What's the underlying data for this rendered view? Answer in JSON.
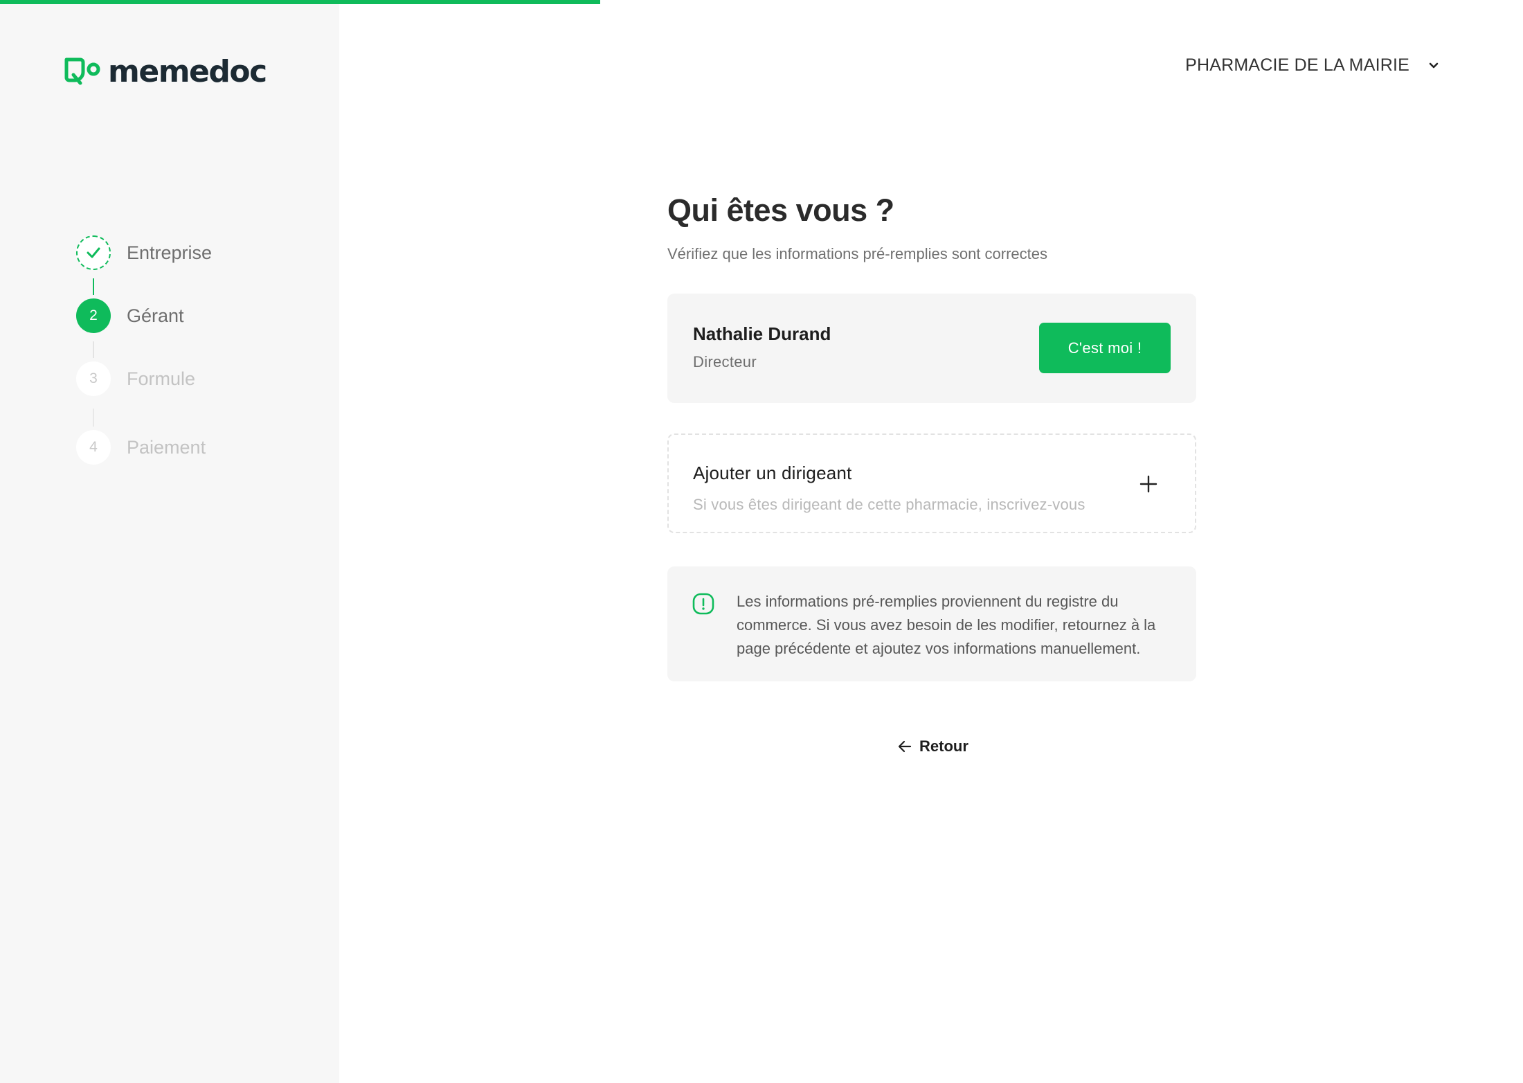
{
  "progress": {
    "fraction": 0.394,
    "color": "#0fbb5b"
  },
  "brand": {
    "name": "memedoc",
    "accent": "#0fbb5b"
  },
  "header": {
    "organization": "PHARMACIE DE LA MAIRIE"
  },
  "steps": [
    {
      "number": "1",
      "label": "Entreprise",
      "status": "done"
    },
    {
      "number": "2",
      "label": "Gérant",
      "status": "active"
    },
    {
      "number": "3",
      "label": "Formule",
      "status": "todo"
    },
    {
      "number": "4",
      "label": "Paiement",
      "status": "todo"
    }
  ],
  "main": {
    "title": "Qui êtes vous ?",
    "subtitle": "Vérifiez que les informations pré-remplies sont correctes",
    "person": {
      "name": "Nathalie Durand",
      "role": "Directeur",
      "cta": "C'est moi !"
    },
    "add_leader": {
      "title": "Ajouter un dirigeant",
      "description": "Si vous êtes dirigeant de cette pharmacie, inscrivez-vous"
    },
    "info": "Les informations pré-remplies proviennent du registre du commerce. Si vous avez besoin de les modifier, retournez à la page précédente et ajoutez vos informations manuellement.",
    "back_label": "Retour"
  },
  "icons": {
    "logo": "memedoc-leaf-logo-icon",
    "dropdown": "chevron-down-icon",
    "done": "check-icon",
    "add": "plus-icon",
    "info": "alert-icon",
    "back": "arrow-left-icon"
  }
}
